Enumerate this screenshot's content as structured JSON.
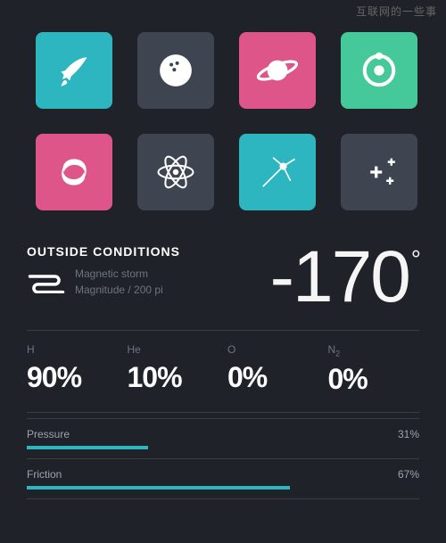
{
  "watermark": "互联网的一些事",
  "tiles": [
    {
      "color": "c-cyan",
      "name": "rocket-icon"
    },
    {
      "color": "c-slate",
      "name": "bowling-ball-icon"
    },
    {
      "color": "c-pink",
      "name": "planet-icon"
    },
    {
      "color": "c-green",
      "name": "orbit-icon"
    },
    {
      "color": "c-pink",
      "name": "galaxy-icon"
    },
    {
      "color": "c-slate",
      "name": "atom-icon"
    },
    {
      "color": "c-cyan",
      "name": "satellite-icon"
    },
    {
      "color": "c-slate",
      "name": "sparkle-icon"
    }
  ],
  "conditions": {
    "title": "OUTSIDE CONDITIONS",
    "line1": "Magnetic storm",
    "line2": "Magnitude / 200 pi",
    "temperature": "-170",
    "unit": "°"
  },
  "composition": [
    {
      "label": "H",
      "value": "90%"
    },
    {
      "label": "He",
      "value": "10%"
    },
    {
      "label": "O",
      "value": "0%"
    },
    {
      "label": "N",
      "sub": "2",
      "value": "0%"
    }
  ],
  "bars": [
    {
      "label": "Pressure",
      "pct": "31%",
      "width": 31
    },
    {
      "label": "Friction",
      "pct": "67%",
      "width": 67
    }
  ]
}
